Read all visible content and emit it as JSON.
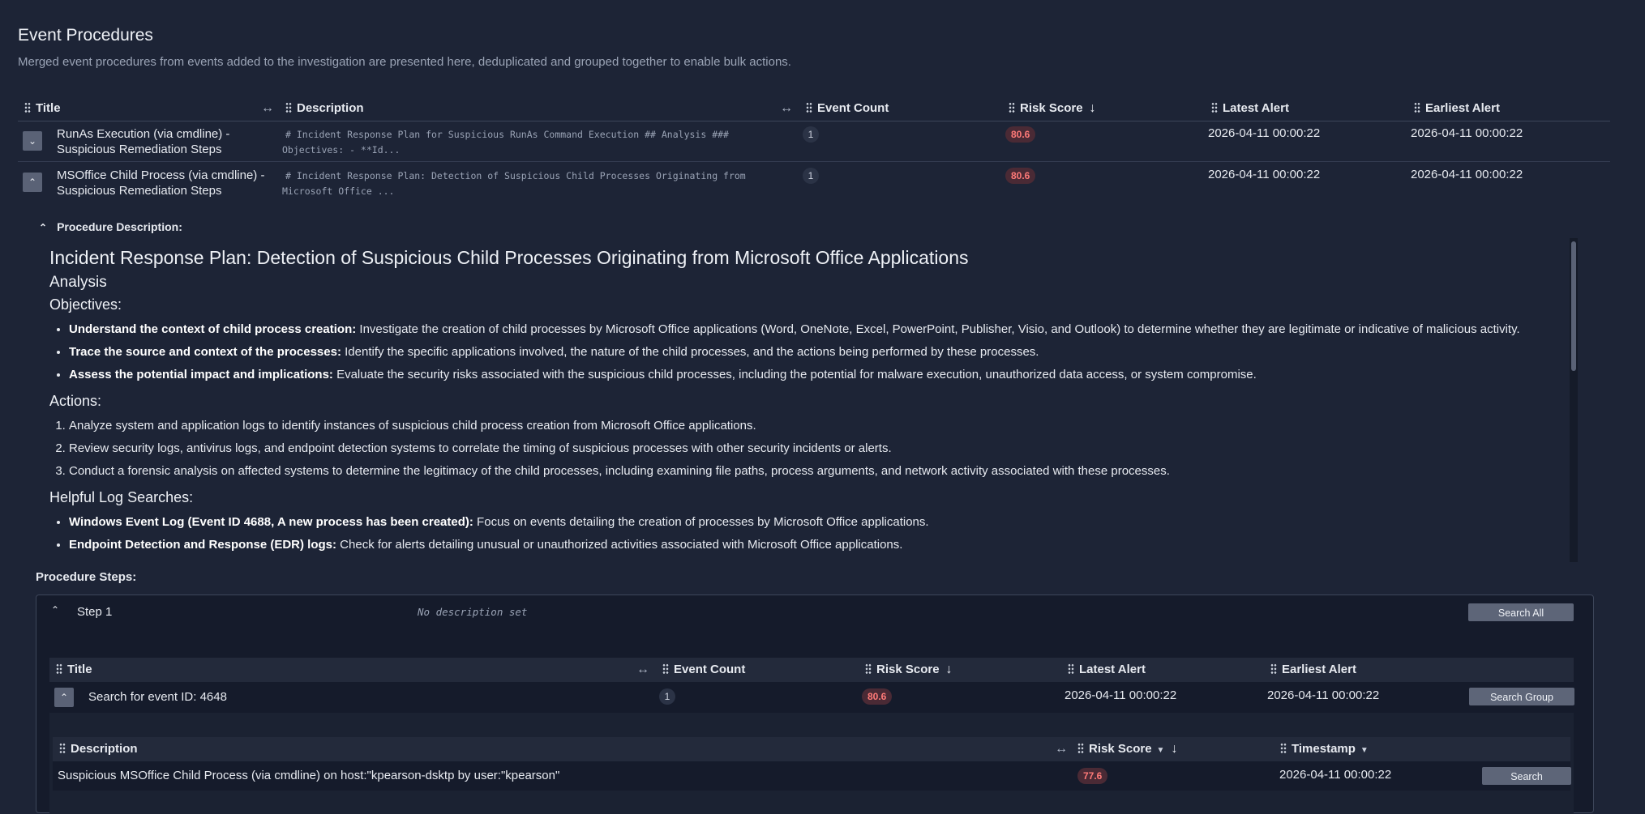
{
  "page": {
    "title": "Event Procedures",
    "subtitle": "Merged event procedures from events added to the investigation are presented here, deduplicated and grouped together to enable bulk actions."
  },
  "main_table": {
    "columns": {
      "title": "Title",
      "description": "Description",
      "event_count": "Event Count",
      "risk_score": "Risk Score",
      "latest_alert": "Latest Alert",
      "earliest_alert": "Earliest Alert"
    },
    "rows": [
      {
        "title_line1": "RunAs Execution (via cmdline) -",
        "title_line2": "Suspicious Remediation Steps",
        "desc_line1": "# Incident Response Plan for Suspicious RunAs Command Execution ## Analysis ###",
        "desc_line2": "Objectives: - **Id...",
        "event_count": "1",
        "risk_score": "80.6",
        "latest_alert": "2026-04-11 00:00:22",
        "earliest_alert": "2026-04-11 00:00:22"
      },
      {
        "title_line1": "MSOffice Child Process (via cmdline) -",
        "title_line2": "Suspicious Remediation Steps",
        "desc_line1": "# Incident Response Plan: Detection of Suspicious Child Processes Originating from",
        "desc_line2": "Microsoft Office ...",
        "event_count": "1",
        "risk_score": "80.6",
        "latest_alert": "2026-04-11 00:00:22",
        "earliest_alert": "2026-04-11 00:00:22"
      }
    ]
  },
  "procedure": {
    "description_label": "Procedure Description:",
    "h1": "Incident Response Plan: Detection of Suspicious Child Processes Originating from Microsoft Office Applications",
    "analysis": "Analysis",
    "objectives_heading": "Objectives:",
    "objectives": [
      {
        "bold": "Understand the context of child process creation:",
        "text": " Investigate the creation of child processes by Microsoft Office applications (Word, OneNote, Excel, PowerPoint, Publisher, Visio, and Outlook) to determine whether they are legitimate or indicative of malicious activity."
      },
      {
        "bold": "Trace the source and context of the processes:",
        "text": " Identify the specific applications involved, the nature of the child processes, and the actions being performed by these processes."
      },
      {
        "bold": "Assess the potential impact and implications:",
        "text": " Evaluate the security risks associated with the suspicious child processes, including the potential for malware execution, unauthorized data access, or system compromise."
      }
    ],
    "actions_heading": "Actions:",
    "actions": [
      "Analyze system and application logs to identify instances of suspicious child process creation from Microsoft Office applications.",
      "Review security logs, antivirus logs, and endpoint detection systems to correlate the timing of suspicious processes with other security incidents or alerts.",
      "Conduct a forensic analysis on affected systems to determine the legitimacy of the child processes, including examining file paths, process arguments, and network activity associated with these processes."
    ],
    "searches_heading": "Helpful Log Searches:",
    "searches": [
      {
        "bold": "Windows Event Log (Event ID 4688, A new process has been created):",
        "text": " Focus on events detailing the creation of processes by Microsoft Office applications."
      },
      {
        "bold": "Endpoint Detection and Response (EDR) logs:",
        "text": " Check for alerts detailing unusual or unauthorized activities associated with Microsoft Office applications."
      }
    ],
    "steps_label": "Procedure Steps:"
  },
  "step": {
    "name": "Step 1",
    "description": "No description set",
    "search_all_label": "Search All",
    "columns": {
      "title": "Title",
      "event_count": "Event Count",
      "risk_score": "Risk Score",
      "latest_alert": "Latest Alert",
      "earliest_alert": "Earliest Alert"
    },
    "group_row": {
      "title": "Search for event ID: 4648",
      "event_count": "1",
      "risk_score": "80.6",
      "latest_alert": "2026-04-11 00:00:22",
      "earliest_alert": "2026-04-11 00:00:22",
      "search_group_label": "Search Group"
    },
    "event_columns": {
      "description": "Description",
      "risk_score": "Risk Score",
      "timestamp": "Timestamp"
    },
    "event_row": {
      "description": "Suspicious MSOffice Child Process (via cmdline) on host:\"kpearson-dsktp by user:\"kpearson\"",
      "risk_score": "77.6",
      "timestamp": "2026-04-11 00:00:22",
      "search_label": "Search"
    }
  },
  "colors": {
    "background": "#1d2436",
    "risk_text": "#ff7a78",
    "risk_badge": "#4a2a35",
    "button": "#5d6578"
  }
}
